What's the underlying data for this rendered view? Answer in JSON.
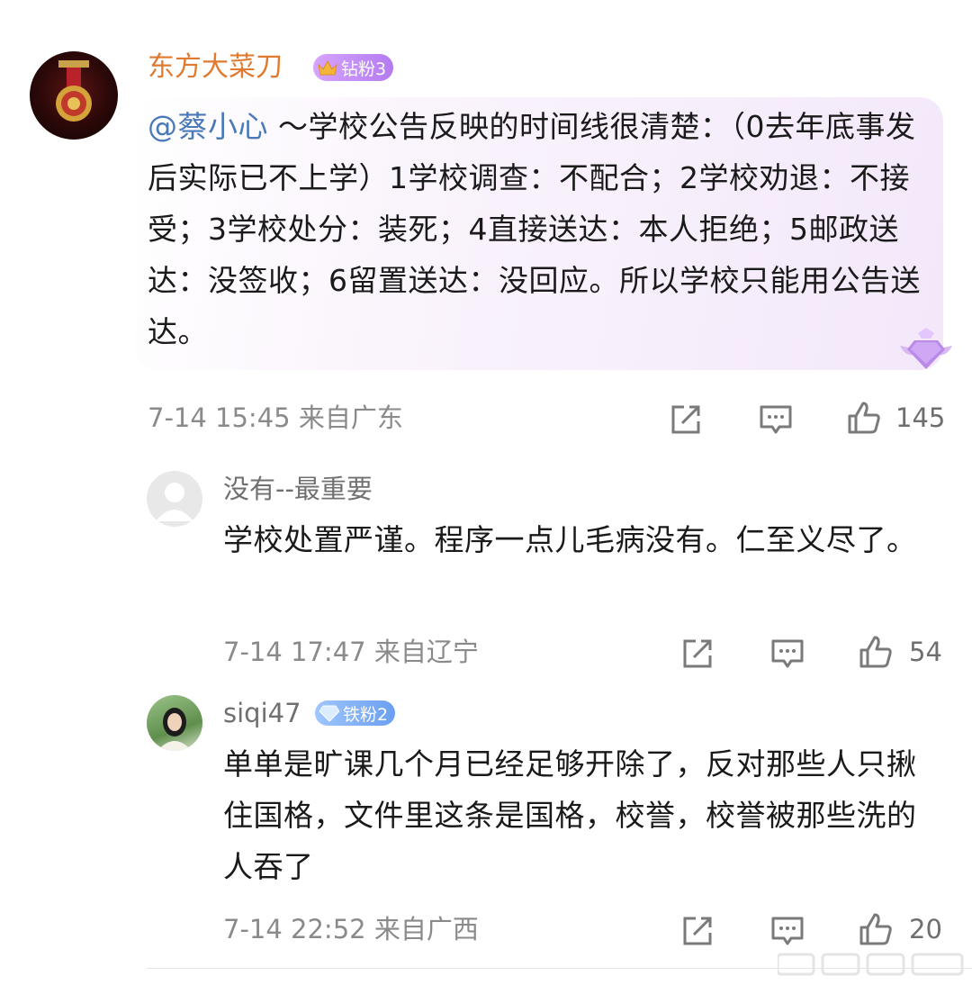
{
  "main_comment": {
    "username": "东方大菜刀",
    "badge": "钻粉3",
    "mention": "@蔡小心",
    "text": " ～学校公告反映的时间线很清楚：（0去年底事发后实际已不上学）1学校调查：不配合；2学校劝退：不接受；3学校处分：装死；4直接送达：本人拒绝；5邮政送达：没签收；6留置送达：没回应。所以学校只能用公告送达。",
    "timestamp": "7-14 15:45",
    "location": "来自广东",
    "likes": "145"
  },
  "replies": [
    {
      "username": "没有--最重要",
      "text": "学校处置严谨。程序一点儿毛病没有。仁至义尽了。",
      "timestamp": "7-14 17:47",
      "location": "来自辽宁",
      "likes": "54"
    },
    {
      "username": "siqi47",
      "badge": "铁粉2",
      "text": "单单是旷课几个月已经足够开除了，反对那些人只揪住国格，文件里这条是国格，校誉，校誉被那些洗的人吞了",
      "timestamp": "7-14 22:52",
      "location": "来自广西",
      "likes": "20"
    }
  ],
  "icons": [
    "share-icon",
    "comment-icon",
    "like-icon"
  ],
  "colors": {
    "username": "#e07a2e",
    "mention": "#4a79b8",
    "meta": "#8a8a8a"
  }
}
